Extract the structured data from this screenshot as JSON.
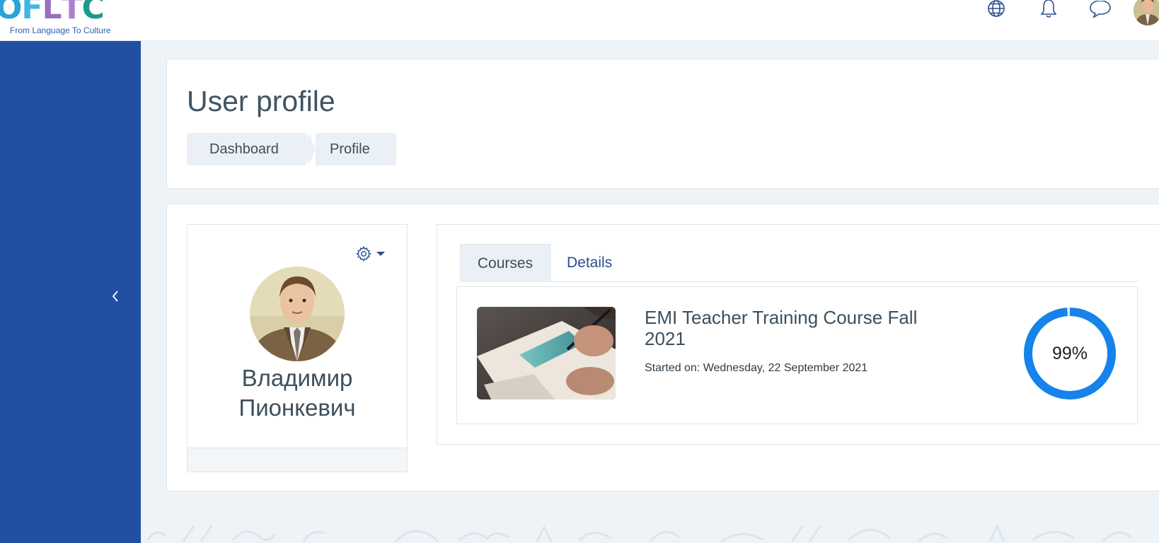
{
  "header": {
    "logo": {
      "letters": [
        "O",
        "F",
        "L",
        "T",
        "C"
      ],
      "letter_colors": [
        "#2aa3d6",
        "#3fb7e0",
        "#9b6fc0",
        "#ae7fcc",
        "#1e9a8c"
      ],
      "tagline": "From Language To Culture"
    },
    "icons": [
      "globe-icon",
      "bell-icon",
      "chat-icon",
      "user-avatar"
    ]
  },
  "sidebar": {
    "background": "#2150a3",
    "toggle_icon": "chevron-left-icon"
  },
  "page": {
    "title": "User profile",
    "breadcrumb": [
      "Dashboard",
      "Profile"
    ]
  },
  "profile": {
    "name": "Владимир Пионкевич",
    "settings_icon": "gear-icon"
  },
  "tabs": [
    {
      "label": "Courses",
      "active": true
    },
    {
      "label": "Details",
      "active": false
    }
  ],
  "course": {
    "title": "EMI Teacher Training Course Fall 2021",
    "started": "Started on: Wednesday, 22 September 2021",
    "progress_percent": 99,
    "progress_label": "99%",
    "progress_color": "#1583ea"
  }
}
